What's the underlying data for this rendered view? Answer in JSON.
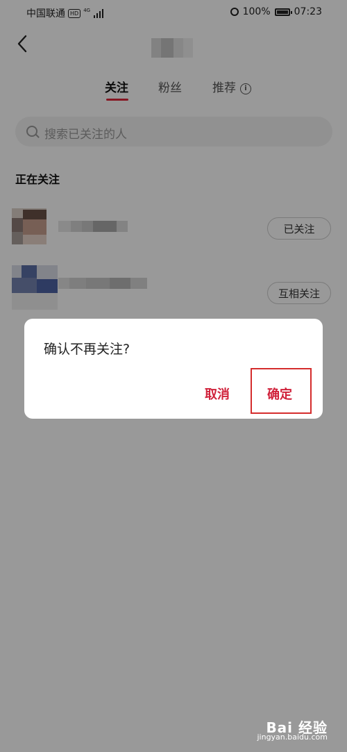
{
  "status_bar": {
    "carrier": "中国联通",
    "hd_badge": "HD",
    "network": "4G",
    "battery": "100%",
    "battery_level": 1.0,
    "time": "07:23"
  },
  "tabs": [
    {
      "label": "关注",
      "active": true
    },
    {
      "label": "粉丝",
      "active": false
    },
    {
      "label": "推荐",
      "active": false
    }
  ],
  "tab_info_icon": "i",
  "search": {
    "placeholder": "搜索已关注的人"
  },
  "section_title": "正在关注",
  "following": [
    {
      "button_label": "已关注"
    },
    {
      "button_label": "互相关注"
    }
  ],
  "dialog": {
    "message": "确认不再关注?",
    "cancel_label": "取消",
    "confirm_label": "确定"
  },
  "watermark": {
    "logo": "Bai 经验",
    "url": "jingyan.baidu.com"
  },
  "colors": {
    "accent": "#d0213a",
    "tab_underline": "#e0263a",
    "highlight_box": "#d42c2c",
    "overlay": "rgba(0,0,0,0.40)"
  },
  "icons": [
    "back-arrow-icon",
    "info-icon",
    "search-icon",
    "alarm-icon",
    "battery-icon",
    "signal-icon"
  ]
}
